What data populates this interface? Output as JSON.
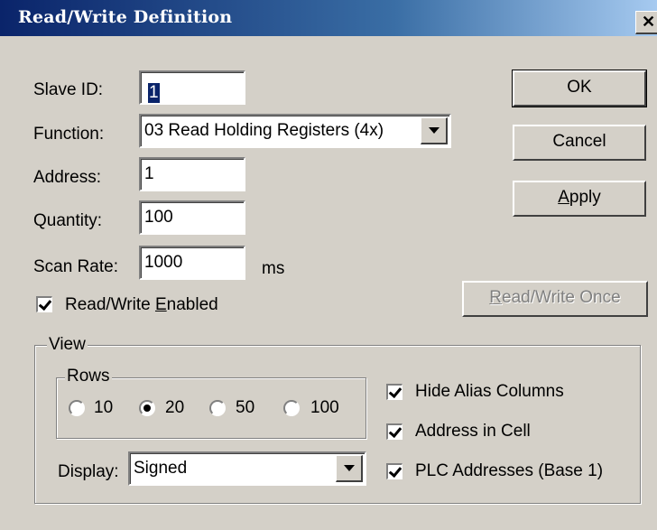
{
  "window": {
    "title": "Read/Write Definition",
    "close_glyph": "✕"
  },
  "fields": {
    "slave_id": {
      "label": "Slave ID:",
      "value": "1"
    },
    "function": {
      "label": "Function:",
      "value": "03 Read Holding Registers (4x)"
    },
    "address": {
      "label": "Address:",
      "value": "1"
    },
    "quantity": {
      "label": "Quantity:",
      "value": "100"
    },
    "scan_rate": {
      "label": "Scan Rate:",
      "value": "1000",
      "unit": "ms"
    }
  },
  "read_write_enabled": {
    "label_pre": "Read/Write ",
    "label_key": "E",
    "label_post": "nabled",
    "checked": true
  },
  "buttons": {
    "ok": "OK",
    "cancel": "Cancel",
    "apply": {
      "key": "A",
      "rest": "pply"
    },
    "read_write_once": {
      "key": "R",
      "rest": "ead/Write Once",
      "disabled": true
    }
  },
  "view": {
    "legend": "View",
    "rows": {
      "legend": "Rows",
      "options": [
        "10",
        "20",
        "50",
        "100"
      ],
      "selected": "20"
    },
    "display": {
      "label": "Display:",
      "value": "Signed"
    },
    "options": {
      "hide_alias": {
        "label": "Hide Alias Columns",
        "checked": true
      },
      "address_in_cell": {
        "label": "Address in Cell",
        "checked": true
      },
      "plc_addresses": {
        "label": "PLC Addresses (Base 1)",
        "checked": true
      }
    }
  }
}
